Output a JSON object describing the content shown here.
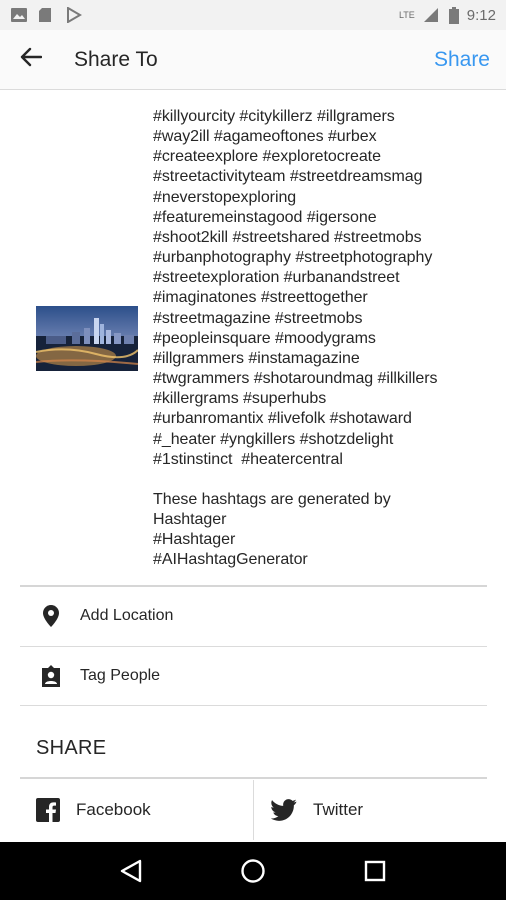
{
  "status_bar": {
    "time": "9:12",
    "network": "LTE"
  },
  "app_bar": {
    "title": "Share To",
    "share_label": "Share"
  },
  "caption": {
    "text": "#killyourcity #citykillerz #illgramers\n#way2ill #agameoftones #urbex\n#createexplore #exploretocreate\n#streetactivityteam #streetdreamsmag\n#neverstopexploring\n#featuremeinstagood #igersone\n#shoot2kill #streetshared #streetmobs\n#urbanphotography #streetphotography\n#streetexploration #urbanandstreet\n#imaginatones #streettogether\n#streetmagazine #streetmobs\n#peopleinsquare #moodygrams\n#illgrammers #instamagazine\n#twgrammers #shotaroundmag #illkillers\n#killergrams #superhubs\n#urbanromantix #livefolk #shotaward\n#_heater #yngkillers #shotzdelight\n#1stinstinct  #heatercentral\n\nThese hashtags are generated by\nHashtager\n#Hashtager\n#AIHashtagGenerator"
  },
  "options": {
    "add_location": "Add Location",
    "tag_people": "Tag People"
  },
  "share_section": {
    "heading": "SHARE",
    "facebook": "Facebook",
    "twitter": "Twitter"
  },
  "colors": {
    "accent": "#3897f0",
    "text": "#262626",
    "divider": "#dbdbdb"
  },
  "icons": [
    "back-arrow-icon",
    "location-pin-icon",
    "tag-person-icon",
    "facebook-icon",
    "twitter-icon",
    "nav-back-icon",
    "nav-home-icon",
    "nav-recents-icon"
  ]
}
